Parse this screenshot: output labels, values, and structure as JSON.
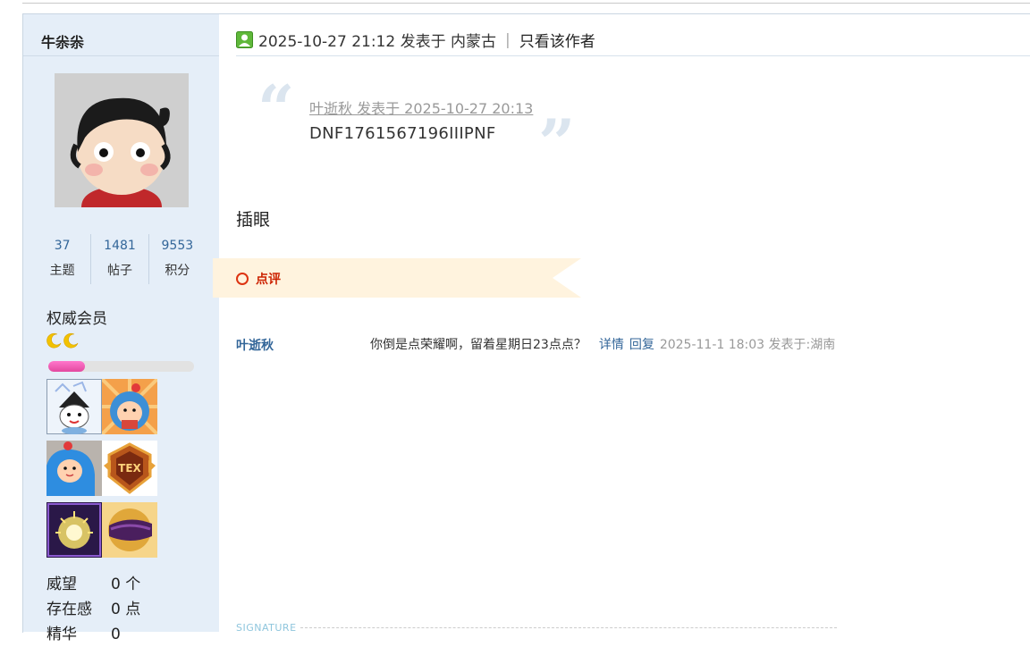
{
  "sidebar": {
    "username": "牛尜尜",
    "stats": [
      {
        "value": "37",
        "label": "主题"
      },
      {
        "value": "1481",
        "label": "帖子"
      },
      {
        "value": "9553",
        "label": "积分"
      }
    ],
    "member_title": "权威会员",
    "level_icons": [
      "moon-icon",
      "moon-icon"
    ],
    "level_progress_percent": 25,
    "medals": [
      "medal-ghost-mage-icon",
      "medal-blue-mascot-cake-icon",
      "medal-blue-mascot-icon",
      "medal-tex-crest-icon",
      "medal-mvp-icon",
      "medal-purple-badge-icon"
    ],
    "info": [
      {
        "key": "威望",
        "value": "0 个"
      },
      {
        "key": "存在感",
        "value": "0 点"
      },
      {
        "key": "精华",
        "value": "0"
      }
    ]
  },
  "post": {
    "header_time": "2025-10-27 21:12 发表于 内蒙古",
    "pipe": "|",
    "only_author": "只看该作者",
    "quote": {
      "author_line": "叶逝秋 发表于 2025-10-27 20:13",
      "text": "DNF1761567196IIIPNF"
    },
    "body": "插眼",
    "comment_section_label": "点评",
    "comments": [
      {
        "author": "叶逝秋",
        "text": "你倒是点荣耀啊，留着星期日23点点？",
        "detail_link": "详情",
        "reply_link": "回复",
        "time": "2025-11-1 18:03 发表于:湖南"
      }
    ],
    "signature_label": "SIGNATURE"
  },
  "colors": {
    "sidebar_bg": "#e5eef8",
    "link": "#336699",
    "comment_label": "#cc2200",
    "progress_fill": "#e3489f",
    "banner_bg": "#fff3de"
  }
}
